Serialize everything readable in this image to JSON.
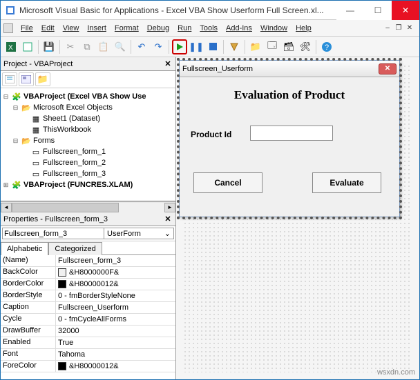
{
  "title": "Microsoft Visual Basic for Applications - Excel VBA Show Userform Full Screen.xl...",
  "win": {
    "min": "—",
    "max": "☐",
    "close": "✕"
  },
  "menus": [
    "File",
    "Edit",
    "View",
    "Insert",
    "Format",
    "Debug",
    "Run",
    "Tools",
    "Add-Ins",
    "Window",
    "Help"
  ],
  "project_pane": {
    "title": "Project - VBAProject",
    "tree": {
      "root": "VBAProject (Excel VBA Show Use",
      "grp1": "Microsoft Excel Objects",
      "s1": "Sheet1 (Dataset)",
      "s2": "ThisWorkbook",
      "grp2": "Forms",
      "f1": "Fullscreen_form_1",
      "f2": "Fullscreen_form_2",
      "f3": "Fullscreen_form_3",
      "root2": "VBAProject (FUNCRES.XLAM)"
    }
  },
  "props_pane": {
    "title": "Properties - Fullscreen_form_3",
    "obj_name": "Fullscreen_form_3",
    "obj_type": "UserForm",
    "tabs": {
      "a": "Alphabetic",
      "c": "Categorized"
    },
    "rows": [
      {
        "k": "(Name)",
        "v": "Fullscreen_form_3"
      },
      {
        "k": "BackColor",
        "v": "&H8000000F&",
        "sw": "#f0f0f0"
      },
      {
        "k": "BorderColor",
        "v": "&H80000012&",
        "sw": "#000000"
      },
      {
        "k": "BorderStyle",
        "v": "0 - fmBorderStyleNone"
      },
      {
        "k": "Caption",
        "v": "Fullscreen_Userform"
      },
      {
        "k": "Cycle",
        "v": "0 - fmCycleAllForms"
      },
      {
        "k": "DrawBuffer",
        "v": "32000"
      },
      {
        "k": "Enabled",
        "v": "True"
      },
      {
        "k": "Font",
        "v": "Tahoma"
      },
      {
        "k": "ForeColor",
        "v": "&H80000012&",
        "sw": "#000000"
      }
    ]
  },
  "userform": {
    "caption": "Fullscreen_Userform",
    "heading": "Evaluation of Product",
    "label": "Product Id",
    "btn_cancel": "Cancel",
    "btn_eval": "Evaluate"
  },
  "watermark": "wsxdn.com"
}
